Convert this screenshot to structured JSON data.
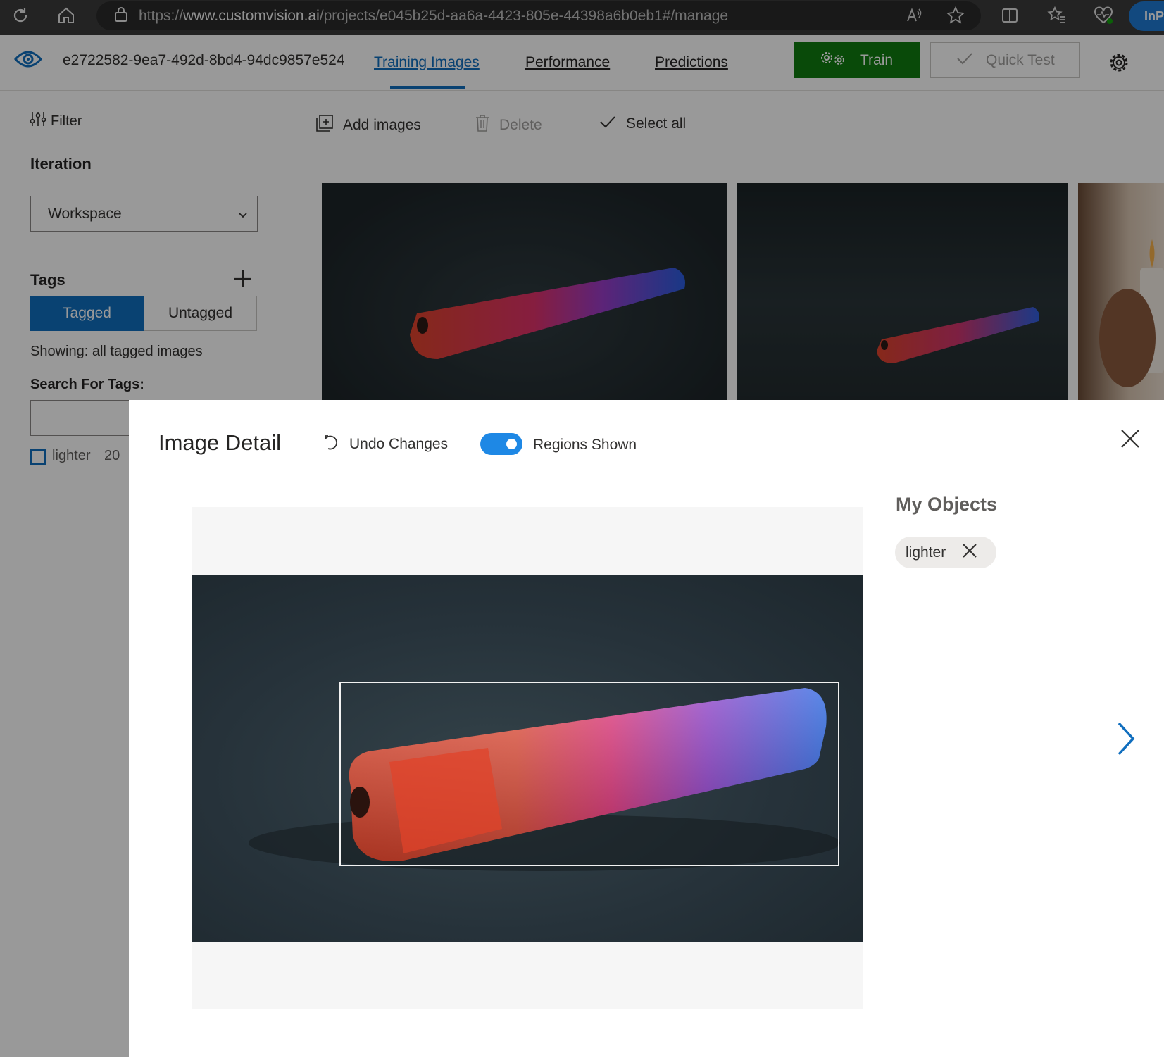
{
  "browser": {
    "url_scheme": "https://",
    "url_host": "www.customvision.ai",
    "url_path": "/projects/e045b25d-aa6a-4423-805e-44398a6b0eb1#/manage",
    "profile_label": "InPr"
  },
  "header": {
    "project_name": "e2722582-9ea7-492d-8bd4-94dc9857e524",
    "tabs": [
      {
        "label": "Training Images",
        "active": true
      },
      {
        "label": "Performance",
        "active": false
      },
      {
        "label": "Predictions",
        "active": false
      }
    ],
    "train_label": "Train",
    "quick_test_label": "Quick Test"
  },
  "sidebar": {
    "filter_label": "Filter",
    "iteration_heading": "Iteration",
    "iteration_value": "Workspace",
    "tags_heading": "Tags",
    "tagged_label": "Tagged",
    "untagged_label": "Untagged",
    "showing_text": "Showing: all tagged images",
    "search_label": "Search For Tags:",
    "search_value": "",
    "tag_items": [
      {
        "label": "lighter",
        "count": "20"
      }
    ]
  },
  "toolbar": {
    "add_images_label": "Add images",
    "delete_label": "Delete",
    "select_all_label": "Select all"
  },
  "modal": {
    "title": "Image Detail",
    "undo_label": "Undo Changes",
    "regions_label": "Regions Shown",
    "regions_shown": true,
    "objects_heading": "My Objects",
    "objects": [
      {
        "label": "lighter"
      }
    ]
  },
  "colors": {
    "accent": "#106ebe",
    "train_green": "#107c10",
    "toggle_blue": "#1e88e5"
  }
}
